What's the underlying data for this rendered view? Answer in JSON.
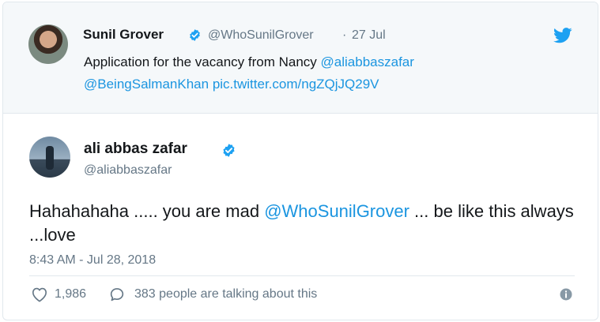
{
  "quoted_tweet": {
    "author_name": "Sunil Grover",
    "author_handle": "@WhoSunilGrover",
    "separator": "·",
    "date": "27 Jul",
    "text_prefix": "Application for the vacancy from Nancy ",
    "mention_1": "@aliabbaszafar",
    "mention_2": "@BeingSalmanKhan",
    "link": "pic.twitter.com/ngZQjJQ29V"
  },
  "main_tweet": {
    "author_name": "ali abbas zafar",
    "author_handle": "@aliabbaszafar",
    "text_before": "Hahahahaha ..... you are mad ",
    "mention": "@WhoSunilGrover",
    "text_after": " ... be like this always ...love",
    "timestamp": "8:43 AM - Jul 28, 2018",
    "like_count": "1,986",
    "talking_text": "383 people are talking about this"
  },
  "colors": {
    "accent": "#1b95e0",
    "muted": "#657786",
    "quoted_bg": "#f5f8fa"
  },
  "icons": [
    "verified-badge-icon",
    "twitter-bird-icon",
    "heart-icon",
    "comment-icon",
    "info-icon"
  ]
}
